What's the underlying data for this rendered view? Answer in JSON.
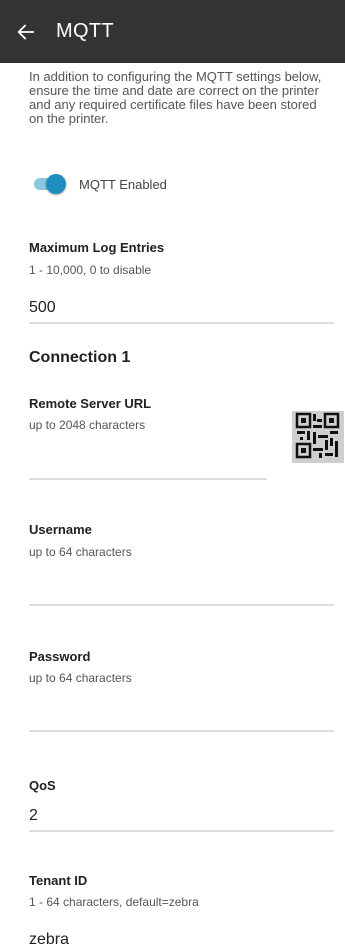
{
  "header": {
    "title": "MQTT",
    "back_icon": "arrow-left-icon"
  },
  "intro_text": "In addition to configuring the MQTT settings below, ensure the time and date are correct on the printer and any required certificate files have been stored on the printer.",
  "mqtt_toggle": {
    "label": "MQTT Enabled",
    "enabled": true,
    "accent_color": "#1f8dbf"
  },
  "max_log": {
    "label": "Maximum Log Entries",
    "hint": "1 - 10,000, 0 to disable",
    "value": "500"
  },
  "connection": {
    "title": "Connection 1",
    "remote_url": {
      "label": "Remote Server URL",
      "hint": "up to 2048 characters",
      "value": "",
      "scan_icon": "qr-code-icon"
    },
    "username": {
      "label": "Username",
      "hint": "up to 64 characters",
      "value": ""
    },
    "password": {
      "label": "Password",
      "hint": "up to 64 characters",
      "value": ""
    },
    "qos": {
      "label": "QoS",
      "value": "2"
    },
    "tenant_id": {
      "label": "Tenant ID",
      "hint": "1 - 64 characters, default=zebra",
      "value": "zebra"
    }
  }
}
